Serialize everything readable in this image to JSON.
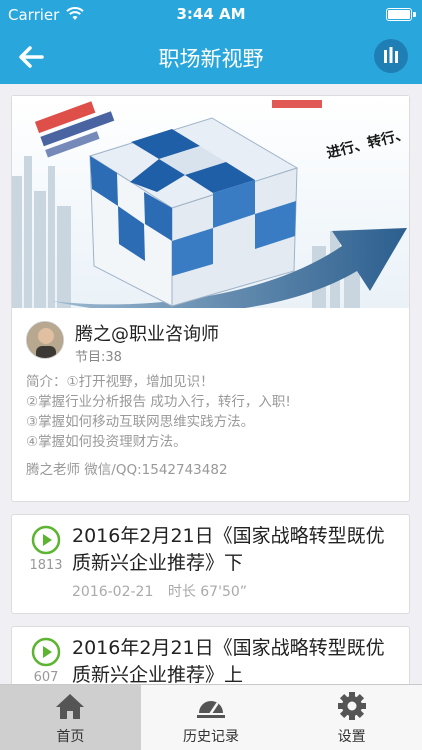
{
  "status_bar": {
    "carrier": "Carrier",
    "time": "3:44 AM"
  },
  "nav": {
    "title": "职场新视野"
  },
  "program": {
    "author": "腾之@职业咨询师",
    "episodes_label": "节目:38",
    "intro_lines": [
      "简介：①打开视野，增加见识！",
      "②掌握行业分析报告 成功入行，转行，入职!",
      "③掌握如何移动互联网思维实践方法。",
      "④掌握如何投资理财方法。"
    ],
    "contact": "腾之老师  微信/QQ:1542743482",
    "banner_texts": [
      "进行、转行、入"
    ]
  },
  "episodes": [
    {
      "title": "2016年2月21日《国家战略转型既优质新兴企业推荐》下",
      "play_count": "1813",
      "date": "2016-02-21",
      "duration": "时长 67'50”"
    },
    {
      "title": "2016年2月21日《国家战略转型既优质新兴企业推荐》上",
      "play_count": "607"
    }
  ],
  "tabs": [
    {
      "label": "首页",
      "icon": "home-icon",
      "active": true
    },
    {
      "label": "历史记录",
      "icon": "history-icon",
      "active": false
    },
    {
      "label": "设置",
      "icon": "settings-icon",
      "active": false
    }
  ],
  "colors": {
    "primary": "#29a7dd",
    "play_green": "#5cb531",
    "tab_active_bg": "#cfcfcf"
  }
}
